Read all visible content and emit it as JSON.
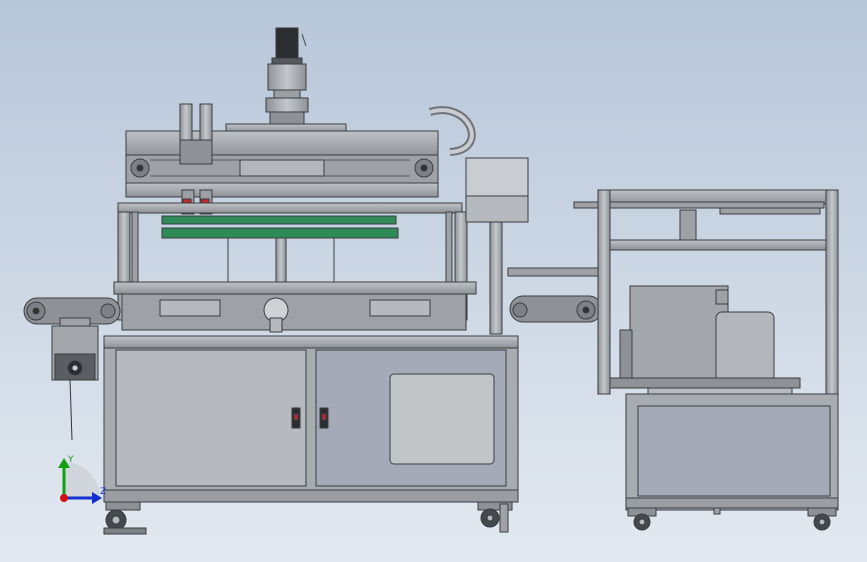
{
  "viewport": {
    "background_top": "#b7c6d9",
    "background_bottom": "#e3e9f0"
  },
  "colors": {
    "frame": "#9a9ea3",
    "frame_dark": "#6f7378",
    "panel": "#a8acb0",
    "panel_light": "#b6b9bd",
    "door_window": "#c2c5c8",
    "squeegee": "#2e8b57",
    "handle_red": "#c0282d",
    "axis_x": "#d01010",
    "axis_y": "#10a010",
    "axis_z": "#1030d0"
  },
  "triad": {
    "y_label": "Y",
    "z_label": "Z"
  },
  "icons": {
    "triad": "coordinate-triad-icon",
    "servo_motor": "servo-motor-icon",
    "caster": "caster-wheel-icon",
    "control_box": "control-box-icon"
  }
}
